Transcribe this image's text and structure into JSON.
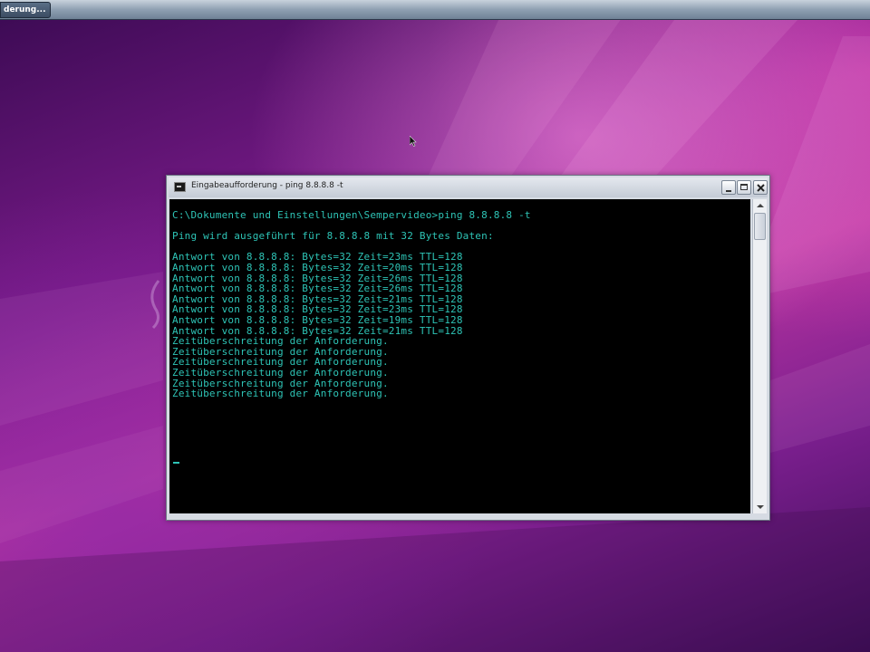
{
  "taskbar": {
    "button_label": "derung..."
  },
  "console_window": {
    "title": "Eingabeaufforderung - ping 8.8.8.8 -t",
    "lines": [
      "C:\\Dokumente und Einstellungen\\Sempervideo>ping 8.8.8.8 -t",
      "",
      "Ping wird ausgeführt für 8.8.8.8 mit 32 Bytes Daten:",
      "",
      "Antwort von 8.8.8.8: Bytes=32 Zeit=23ms TTL=128",
      "Antwort von 8.8.8.8: Bytes=32 Zeit=20ms TTL=128",
      "Antwort von 8.8.8.8: Bytes=32 Zeit=26ms TTL=128",
      "Antwort von 8.8.8.8: Bytes=32 Zeit=26ms TTL=128",
      "Antwort von 8.8.8.8: Bytes=32 Zeit=21ms TTL=128",
      "Antwort von 8.8.8.8: Bytes=32 Zeit=23ms TTL=128",
      "Antwort von 8.8.8.8: Bytes=32 Zeit=19ms TTL=128",
      "Antwort von 8.8.8.8: Bytes=32 Zeit=21ms TTL=128",
      "Zeitüberschreitung der Anforderung.",
      "Zeitüberschreitung der Anforderung.",
      "Zeitüberschreitung der Anforderung.",
      "Zeitüberschreitung der Anforderung.",
      "Zeitüberschreitung der Anforderung.",
      "Zeitüberschreitung der Anforderung."
    ],
    "text_color": "#2ec4b6",
    "background_color": "#000000"
  },
  "icons": {
    "app": "console-icon",
    "minimize": "minimize-icon",
    "maximize": "maximize-icon",
    "close": "close-icon",
    "cursor": "mouse-cursor-icon"
  }
}
